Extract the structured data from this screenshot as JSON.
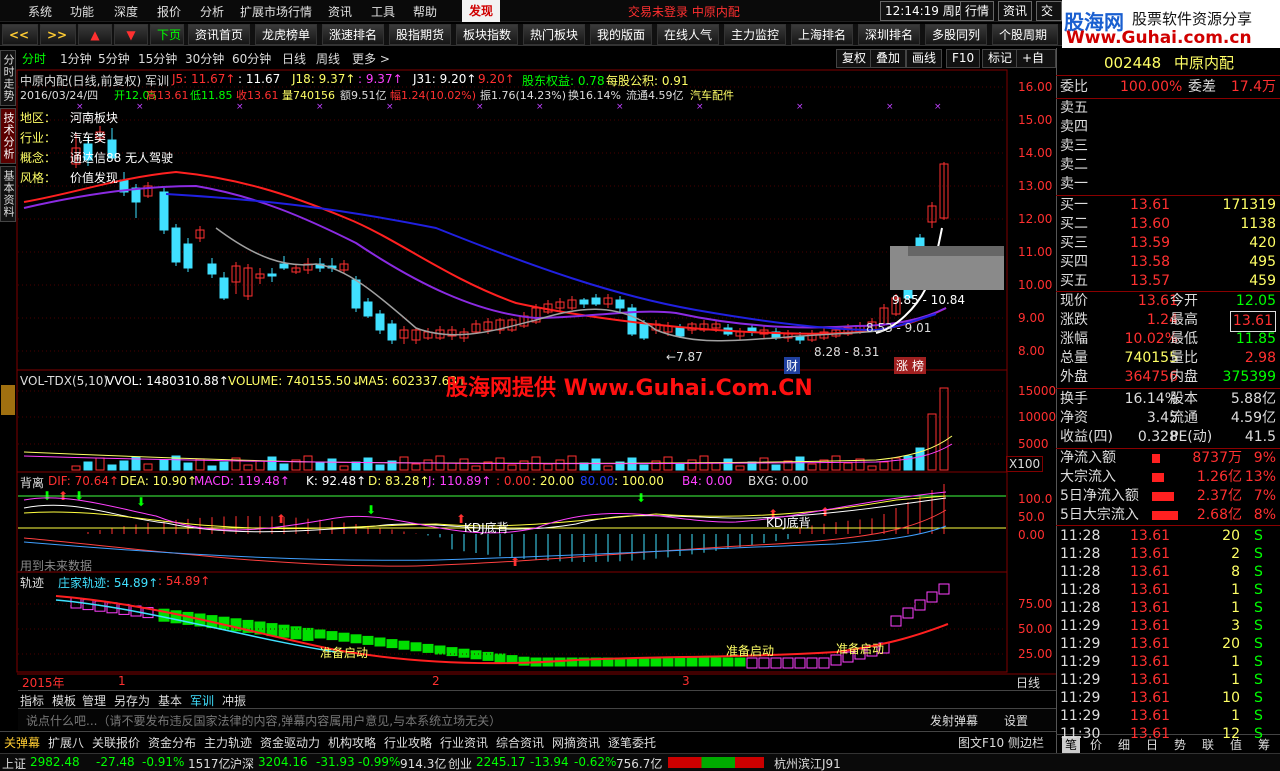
{
  "menu": [
    "系统",
    "功能",
    "深度",
    "报价",
    "分析",
    "扩展市场行情",
    "资讯",
    "工具",
    "帮助"
  ],
  "faxian": "发现",
  "status_msg": "交易未登录   中原内配",
  "clock": "12:14:19 周四",
  "top_right": [
    "行情",
    "资讯",
    "交易"
  ],
  "logo": {
    "name": "股海网",
    "slogan": "股票软件资源分享",
    "url": "Www.Guhai.com.cn"
  },
  "toolbar": [
    "资讯首页",
    "龙虎榜单",
    "涨速排名",
    "股指期货",
    "板块指数",
    "热门板块",
    "我的版面",
    "在线人气",
    "主力监控",
    "上海排名",
    "深圳排名",
    "多股同列",
    "个股周期"
  ],
  "toolbar_nav": [
    "<<",
    ">>",
    "▲",
    "▼",
    "下页"
  ],
  "vtabs": [
    "分时走势",
    "技术分析",
    "基本资料"
  ],
  "periods": [
    "分时",
    "1分钟",
    "5分钟",
    "15分钟",
    "30分钟",
    "60分钟",
    "日线",
    "周线",
    "更多 >"
  ],
  "chart_buttons": [
    "复权",
    "叠加",
    "画线",
    "F10",
    "标记",
    "+自选"
  ],
  "main_chart": {
    "title": "中原内配(日线,前复权) 军训",
    "j5": "J5: 11.67↑",
    "j5b": ": 11.67",
    "j18": "J18: 9.37↑",
    "j18b": ": 9.37↑",
    "j31": "J31: 9.20↑",
    "j31b": "9.20↑",
    "holder": "股东权益: 0.78",
    "gjj": "每股公积: 0.91",
    "info_date": "2016/03/24/四",
    "open": "开12.05",
    "high": "高13.61",
    "low": "低11.85",
    "close": "收13.61",
    "vol": "量740156",
    "amt": "额9.51亿",
    "chg": "幅1.24(10.02%)",
    "amp": "振1.76(14.23%)",
    "turnover": "换16.14%",
    "float": "流通4.59亿",
    "sector": "汽车配件",
    "region": "地区：",
    "region_v": "河南板块",
    "industry": "行业：",
    "industry_v": "汽车类",
    "concept": "概念：",
    "concept_v": "通达信88 无人驾驶",
    "style": "风格：",
    "style_v": "价值发现",
    "annot_low": "←7.87",
    "annot_range1": "8.28 - 8.31",
    "annot_range2": "9.85 - 10.84",
    "annot_range3": "8.53 - 9.01",
    "cai": "财",
    "zhang": "涨",
    "bang": "榜"
  },
  "price_axis": [
    "16.00",
    "15.00",
    "14.00",
    "13.00",
    "12.00",
    "11.00",
    "10.00",
    "9.00",
    "8.00"
  ],
  "vol_chart": {
    "title": "VOL-TDX(5,10)",
    "vvol": "VVOL: 1480310.88↑",
    "volume": "VOLUME: 740155.50↓",
    "ma5": "MA5: 602337.63↑",
    "axis": [
      "15000",
      "10000",
      "5000",
      "X100"
    ]
  },
  "watermark": "股海网提供 Www.Guhai.Com.CN",
  "macd_chart": {
    "title": "背离",
    "dif": "DIF: 70.64↑",
    "dea": "DEA: 10.90↑",
    "macd": "MACD: 119.48↑",
    "k": "K: 92.48↑",
    "d": "D: 83.28↑",
    "j": "J: 110.89↑",
    "r0": ": 0.00",
    ": 20": ": 20.00",
    "b80": "80.00",
    ": 100": ": 100.00",
    "b4": "B4: 0.00",
    "bxg": "BXG: 0.00",
    "kdj1": "KDJ底背",
    "kdj2": "KDJ底背",
    "future": "用到未来数据",
    "axis": [
      "100.0",
      "50.0",
      "0.00"
    ]
  },
  "track_chart": {
    "title": "轨迹",
    "zj": "庄家轨迹: 54.89↑",
    "zj2": ": 54.89↑",
    "start1": "准备启动",
    "start2": "准备启动",
    "start3": "准备启动",
    "axis": [
      "75.00",
      "50.00",
      "25.00"
    ]
  },
  "date_axis": {
    "year": "2015年",
    "m1": "1",
    "m2": "2",
    "m3": "3",
    "dline": "日线"
  },
  "bottom_tabs": [
    "指标",
    "模板",
    "管理",
    "另存为",
    "基本",
    "军训",
    "冲振"
  ],
  "comment": {
    "placeholder": "说点什么吧...（请不要发布违反国家法律的内容,弹幕内容属用户意见,与本系统立场无关）",
    "send": "发射弹幕",
    "settings": "设置"
  },
  "func_bar": [
    "关弹幕",
    "扩展八",
    "关联报价",
    "资金分布",
    "主力轨迹",
    "资金驱动力",
    "机构攻略",
    "行业攻略",
    "行业资讯",
    "综合资讯",
    "网摘资讯",
    "逐笔委托"
  ],
  "func_right": [
    "图文F10",
    "侧边栏"
  ],
  "stock": {
    "code": "002448",
    "name": "中原内配"
  },
  "weibi": {
    "l": "委比",
    "v": "100.00%",
    "l2": "委差",
    "v2": "17.4万"
  },
  "sells": [
    {
      "l": "卖五"
    },
    {
      "l": "卖四"
    },
    {
      "l": "卖三"
    },
    {
      "l": "卖二"
    },
    {
      "l": "卖一"
    }
  ],
  "buys": [
    {
      "l": "买一",
      "p": "13.61",
      "v": "171319"
    },
    {
      "l": "买二",
      "p": "13.60",
      "v": "1138"
    },
    {
      "l": "买三",
      "p": "13.59",
      "v": "420"
    },
    {
      "l": "买四",
      "p": "13.58",
      "v": "495"
    },
    {
      "l": "买五",
      "p": "13.57",
      "v": "459"
    }
  ],
  "quote": [
    {
      "a": "现价",
      "b": "13.61",
      "c": "今开",
      "d": "12.05"
    },
    {
      "a": "涨跌",
      "b": "1.24",
      "c": "最高",
      "d": "13.61"
    },
    {
      "a": "涨幅",
      "b": "10.02%",
      "c": "最低",
      "d": "11.85"
    },
    {
      "a": "总量",
      "b": "740155",
      "c": "量比",
      "d": "2.98"
    },
    {
      "a": "外盘",
      "b": "364756",
      "c": "内盘",
      "d": "375399"
    }
  ],
  "fund": [
    {
      "a": "换手",
      "b": "16.14%",
      "c": "股本",
      "d": "5.88亿"
    },
    {
      "a": "净资",
      "b": "3.45",
      "c": "流通",
      "d": "4.59亿"
    },
    {
      "a": "收益(四)",
      "b": "0.328",
      "c": "PE(动)",
      "d": "41.5"
    }
  ],
  "flows": [
    {
      "l": "净流入额",
      "v": "8737万",
      "p": "9%",
      "w": 8
    },
    {
      "l": "大宗流入",
      "v": "1.26亿",
      "p": "13%",
      "w": 12
    },
    {
      "l": "5日净流入额",
      "v": "2.37亿",
      "p": "7%",
      "w": 22
    },
    {
      "l": "5日大宗流入",
      "v": "2.68亿",
      "p": "8%",
      "w": 26
    }
  ],
  "ticks": [
    [
      "11:28",
      "13.61",
      "20",
      "S"
    ],
    [
      "11:28",
      "13.61",
      "2",
      "S"
    ],
    [
      "11:28",
      "13.61",
      "8",
      "S"
    ],
    [
      "11:28",
      "13.61",
      "1",
      "S"
    ],
    [
      "11:28",
      "13.61",
      "1",
      "S"
    ],
    [
      "11:29",
      "13.61",
      "3",
      "S"
    ],
    [
      "11:29",
      "13.61",
      "20",
      "S"
    ],
    [
      "11:29",
      "13.61",
      "1",
      "S"
    ],
    [
      "11:29",
      "13.61",
      "1",
      "S"
    ],
    [
      "11:29",
      "13.61",
      "10",
      "S"
    ],
    [
      "11:29",
      "13.61",
      "1",
      "S"
    ],
    [
      "11:30",
      "13.61",
      "12",
      "S"
    ]
  ],
  "rp_tabs": [
    "笔",
    "价",
    "细",
    "日",
    "势",
    "联",
    "值",
    "筹"
  ],
  "statusbar": {
    "sh": "上证",
    "sh_v": "2982.48",
    "sh_c": "-27.48",
    "sh_p": "-0.91%",
    "sh_a": "1517亿",
    "hs": "沪深",
    "hs_v": "3204.16",
    "hs_c": "-31.93",
    "hs_p": "-0.99%",
    "hs_a": "914.3亿",
    "cy": "创业",
    "cy_v": "2245.17",
    "cy_c": "-13.94",
    "cy_p": "-0.62%",
    "cy_a": "756.7亿",
    "loc": "杭州滨江J91"
  }
}
